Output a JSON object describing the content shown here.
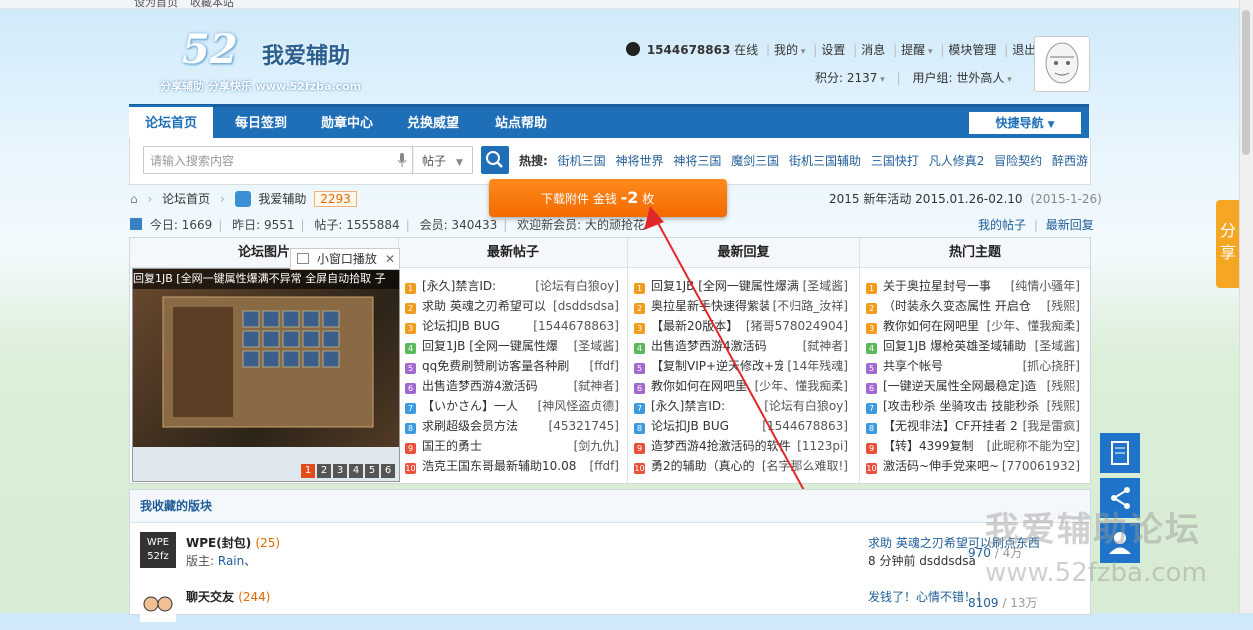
{
  "top_strip": {
    "set_home": "设为首页",
    "bookmark": "收藏本站"
  },
  "logo": {
    "number": "52",
    "title": "我爱辅助",
    "slogan": "分享辅助  分享快乐  www.52fzba.com"
  },
  "user": {
    "qq": "1544678863",
    "status": "在线",
    "menu": [
      "我的",
      "设置",
      "消息",
      "提醒",
      "模块管理",
      "退出"
    ],
    "points_label": "积分: 2137",
    "group_label": "用户组: 世外高人"
  },
  "nav": {
    "items": [
      "论坛首页",
      "每日签到",
      "勋章中心",
      "兑换威望",
      "站点帮助"
    ],
    "quick": "快捷导航"
  },
  "search": {
    "placeholder": "请输入搜索内容",
    "scope": "帖子",
    "hot_label": "热搜:",
    "hot": [
      "街机三国",
      "神将世界",
      "神将三国",
      "魔剑三国",
      "街机三国辅助",
      "三国快打",
      "凡人修真2",
      "冒险契约",
      "醉西游"
    ]
  },
  "breadcrumb": {
    "home": "论坛首页",
    "forum": "我爱辅助",
    "count": "2293"
  },
  "event": {
    "text": "2015 新年活动 2015.01.26-02.10",
    "date": "(2015-1-26)"
  },
  "stats": {
    "today": "今日: 1669",
    "yesterday": "昨日: 9551",
    "posts": "帖子: 1555884",
    "members": "会员: 340433",
    "welcome": "欢迎新会员: 大的顽抢花"
  },
  "my_links": {
    "my_posts": "我的帖子",
    "latest": "最新回复"
  },
  "popup": {
    "text": "下载附件   金钱",
    "value": "-2",
    "unit": "枚"
  },
  "columns": {
    "images": "论坛图片",
    "new_posts": "最新帖子",
    "new_replies": "最新回复",
    "hot": "热门主题"
  },
  "mini_player": "小窗口播放",
  "slide": {
    "caption": "回复1JB [全网一键属性爆满不异常 全屏自动拾取 子",
    "pages": [
      "1",
      "2",
      "3",
      "4",
      "5",
      "6"
    ]
  },
  "new_posts": [
    {
      "t": "[永久]禁言ID:",
      "a": "[论坛有白狼oy]"
    },
    {
      "t": "求助 英魂之刃希望可以",
      "a": "[dsddsdsa]"
    },
    {
      "t": "论坛扣JB BUG",
      "a": "[1544678863]"
    },
    {
      "t": "回复1JB [全网一键属性爆",
      "a": "[圣域酱]"
    },
    {
      "t": "qq免费刷赞刷访客量各种刷",
      "a": "[ffdf]"
    },
    {
      "t": "出售造梦西游4激活码",
      "a": "[弑神者]"
    },
    {
      "t": "【いかさん】一人",
      "a": "[神风怪盗贞德]"
    },
    {
      "t": "求刷超级会员方法",
      "a": "[45321745]"
    },
    {
      "t": "国王的勇士",
      "a": "[剑九仇]"
    },
    {
      "t": "浩克王国东哥最新辅助10.08",
      "a": "[ffdf]"
    }
  ],
  "new_replies": [
    {
      "t": "回复1JB [全网一键属性爆满",
      "a": "[圣域酱]"
    },
    {
      "t": "奥拉星新手快速得紫装",
      "a": "[不归路_汝祥]"
    },
    {
      "t": "【最新20版本】",
      "a": "[猪哥578024904]"
    },
    {
      "t": "出售造梦西游4激活码",
      "a": "[弑神者]"
    },
    {
      "t": "【复制VIP+逆天修改+宠",
      "a": "[14年残魂]"
    },
    {
      "t": "教你如何在网吧里",
      "a": "[少年、懂我痴柔]"
    },
    {
      "t": "[永久]禁言ID:",
      "a": "[论坛有白狼oy]"
    },
    {
      "t": "论坛扣JB BUG",
      "a": "[1544678863]"
    },
    {
      "t": "造梦西游4抢激活码的软件",
      "a": "[1123pi]"
    },
    {
      "t": "勇2的辅助（真心的",
      "a": "[名字那么难取!]"
    }
  ],
  "hot_topics": [
    {
      "t": "关于奥拉星封号一事",
      "a": "[纯情小骚年]"
    },
    {
      "t": "（时装永久变态属性 开启仓",
      "a": "[残熙]"
    },
    {
      "t": "教你如何在网吧里",
      "a": "[少年、懂我痴柔]"
    },
    {
      "t": "回复1JB 爆枪英雄圣域辅助",
      "a": "[圣域酱]"
    },
    {
      "t": "共享个帐号",
      "a": "[抓心挠肝]"
    },
    {
      "t": "[一键逆天属性全网最稳定]造",
      "a": "[残熙]"
    },
    {
      "t": "[攻击秒杀 坐骑攻击 技能秒杀",
      "a": "[残熙]"
    },
    {
      "t": "【无视非法】CF开挂者 2",
      "a": "[我是雷疯]"
    },
    {
      "t": "【转】4399复制",
      "a": "[此昵称不能为空]"
    },
    {
      "t": "激活码~伸手党来吧~",
      "a": "[770061932]"
    }
  ],
  "favorites": {
    "title": "我收藏的版块",
    "forums": [
      {
        "icon": "WPE 52fz",
        "name": "WPE(封包)",
        "count": "(25)",
        "mod_label": "版主:",
        "mod": "Rain、",
        "threads": "970",
        "posts": "4万",
        "last_title": "求助 英魂之刃希望可以刷点东西",
        "last_info": "8 分钟前 dsddsdsa"
      },
      {
        "icon": "",
        "name": "聊天交友",
        "count": "(244)",
        "mod_label": "",
        "mod": "",
        "threads": "8109",
        "posts": "13万",
        "last_title": "发钱了！心情不错！！",
        "last_info": ""
      }
    ]
  },
  "side_tab": "分享",
  "watermark": {
    "line1": "我爱辅助论坛",
    "line2": "www.52fzba.com"
  },
  "colors": {
    "nav_blue": "#1f6fb8",
    "orange": "#f26a00",
    "link": "#1f5d99"
  }
}
